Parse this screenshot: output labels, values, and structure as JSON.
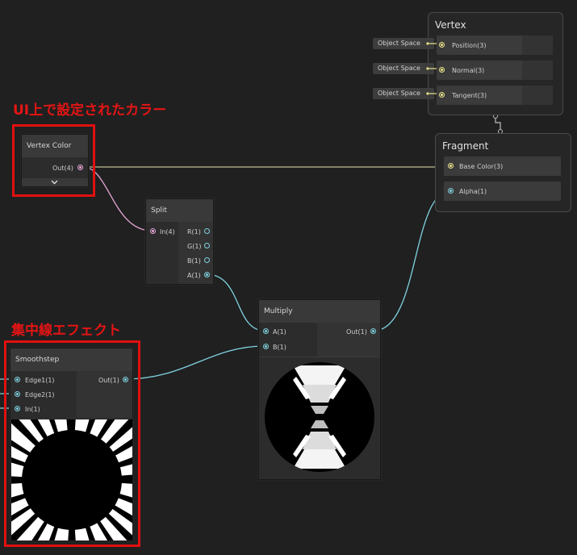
{
  "annotations": {
    "vertex_color_note": "UI上で設定されたカラー",
    "speedline_note": "集中線エフェクト"
  },
  "nodes": {
    "vertex_color": {
      "title": "Vertex Color",
      "output": "Out(4)"
    },
    "split": {
      "title": "Split",
      "input": "In(4)",
      "outputs": [
        "R(1)",
        "G(1)",
        "B(1)",
        "A(1)"
      ]
    },
    "multiply": {
      "title": "Multiply",
      "inputs": [
        "A(1)",
        "B(1)"
      ],
      "output": "Out(1)"
    },
    "smoothstep": {
      "title": "Smoothstep",
      "inputs": [
        "Edge1(1)",
        "Edge2(1)",
        "In(1)"
      ],
      "output": "Out(1)"
    }
  },
  "contexts": {
    "vertex": {
      "title": "Vertex",
      "blocks": [
        {
          "label": "Position(3)",
          "space": "Object Space"
        },
        {
          "label": "Normal(3)",
          "space": "Object Space"
        },
        {
          "label": "Tangent(3)",
          "space": "Object Space"
        }
      ]
    },
    "fragment": {
      "title": "Fragment",
      "blocks": [
        {
          "label": "Base Color(3)"
        },
        {
          "label": "Alpha(1)"
        }
      ]
    }
  },
  "colors": {
    "vector4_port": "#e6a6d6",
    "vector3_port": "#ece58a",
    "float_port": "#7fd3e0",
    "highlight_frame": "#e01010"
  },
  "icons": {
    "expand": "chevron-down-icon"
  }
}
